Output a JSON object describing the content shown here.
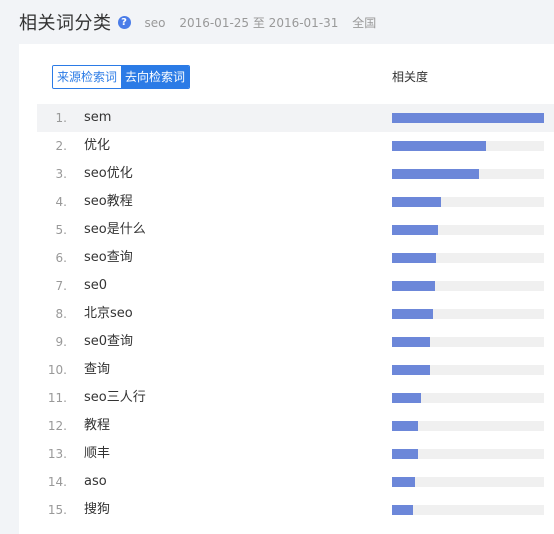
{
  "header": {
    "title": "相关词分类",
    "help_glyph": "?",
    "keyword": "seo",
    "date_range": "2016-01-25 至 2016-01-31",
    "region": "全国"
  },
  "toggle": {
    "source_label": "来源检索词",
    "target_label": "去向检索词",
    "selected": "去向检索词"
  },
  "column_header": "相关度",
  "colors": {
    "accent": "#2b7be6",
    "bar": "#6c87d9",
    "track": "#f0f0f0"
  },
  "rows": [
    {
      "rank": "1.",
      "keyword": "sem",
      "relevance": 1.0
    },
    {
      "rank": "2.",
      "keyword": "优化",
      "relevance": 0.62
    },
    {
      "rank": "3.",
      "keyword": "seo优化",
      "relevance": 0.57
    },
    {
      "rank": "4.",
      "keyword": "seo教程",
      "relevance": 0.32
    },
    {
      "rank": "5.",
      "keyword": "seo是什么",
      "relevance": 0.3
    },
    {
      "rank": "6.",
      "keyword": "seo查询",
      "relevance": 0.29
    },
    {
      "rank": "7.",
      "keyword": "se0",
      "relevance": 0.28
    },
    {
      "rank": "8.",
      "keyword": "北京seo",
      "relevance": 0.27
    },
    {
      "rank": "9.",
      "keyword": "se0查询",
      "relevance": 0.25
    },
    {
      "rank": "10.",
      "keyword": "查询",
      "relevance": 0.25
    },
    {
      "rank": "11.",
      "keyword": "seo三人行",
      "relevance": 0.19
    },
    {
      "rank": "12.",
      "keyword": "教程",
      "relevance": 0.17
    },
    {
      "rank": "13.",
      "keyword": "顺丰",
      "relevance": 0.17
    },
    {
      "rank": "14.",
      "keyword": "aso",
      "relevance": 0.15
    },
    {
      "rank": "15.",
      "keyword": "搜狗",
      "relevance": 0.14
    }
  ]
}
